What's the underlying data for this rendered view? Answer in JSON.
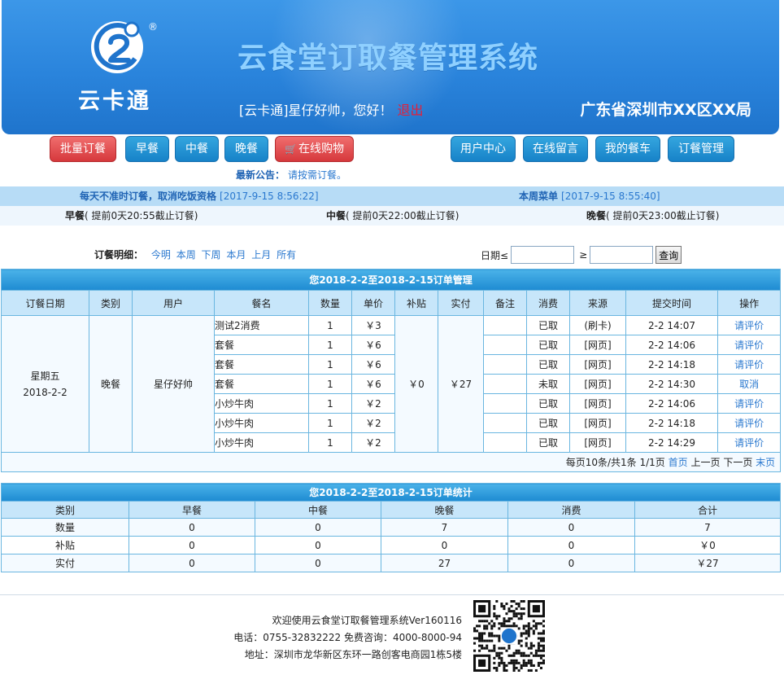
{
  "brand": {
    "name": "云卡通",
    "registered": "®",
    "system_title": "云食堂订取餐管理系统"
  },
  "header": {
    "greeting": "[云卡通]星仔好帅，您好！",
    "logout": "退出",
    "location": "广东省深圳市XX区XX局"
  },
  "nav": {
    "batch_order": "批量订餐",
    "breakfast": "早餐",
    "lunch": "中餐",
    "dinner": "晚餐",
    "shop": "在线购物",
    "user_center": "用户中心",
    "message": "在线留言",
    "cart": "我的餐车",
    "order_manage": "订餐管理"
  },
  "notice": {
    "label": "最新公告：",
    "text": "请按需订餐。"
  },
  "info_bar": {
    "left_text": "每天不准时订餐，取消吃饭资格",
    "left_time": "[2017-9-15 8:56:22]",
    "right_text": "本周菜单",
    "right_time": "[2017-9-15 8:55:40]"
  },
  "meal_times": {
    "breakfast": {
      "name": "早餐",
      "rule": "( 提前0天20:55截止订餐)"
    },
    "lunch": {
      "name": "中餐",
      "rule": "( 提前0天22:00截止订餐)"
    },
    "dinner": {
      "name": "晚餐",
      "rule": "( 提前0天23:00截止订餐)"
    }
  },
  "filter": {
    "label": "订餐明细：",
    "links": [
      "今明",
      "本周",
      "下周",
      "本月",
      "上月",
      "所有"
    ],
    "date_label": "日期≤",
    "ge": "≥",
    "date_from": "",
    "date_to": "",
    "query": "查询"
  },
  "orders": {
    "caption": "您2018-2-2至2018-2-15订单管理",
    "columns": [
      "订餐日期",
      "类别",
      "用户",
      "餐名",
      "数量",
      "单价",
      "补贴",
      "实付",
      "备注",
      "消费",
      "来源",
      "提交时间",
      "操作"
    ],
    "day": "星期五",
    "date": "2018-2-2",
    "category": "晚餐",
    "user": "星仔好帅",
    "subsidy": "￥0",
    "paid": "￥27",
    "rows": [
      {
        "meal": "测试2消费",
        "qty": "1",
        "price": "￥3",
        "remark": "",
        "status": "已取",
        "source": "(刷卡)",
        "time": "2-2 14:07",
        "action": "请评价"
      },
      {
        "meal": "套餐",
        "qty": "1",
        "price": "￥6",
        "remark": "",
        "status": "已取",
        "source": "[网页]",
        "time": "2-2 14:06",
        "action": "请评价"
      },
      {
        "meal": "套餐",
        "qty": "1",
        "price": "￥6",
        "remark": "",
        "status": "已取",
        "source": "[网页]",
        "time": "2-2 14:18",
        "action": "请评价"
      },
      {
        "meal": "套餐",
        "qty": "1",
        "price": "￥6",
        "remark": "",
        "status": "未取",
        "source": "[网页]",
        "time": "2-2 14:30",
        "action": "取消"
      },
      {
        "meal": "小炒牛肉",
        "qty": "1",
        "price": "￥2",
        "remark": "",
        "status": "已取",
        "source": "[网页]",
        "time": "2-2 14:06",
        "action": "请评价"
      },
      {
        "meal": "小炒牛肉",
        "qty": "1",
        "price": "￥2",
        "remark": "",
        "status": "已取",
        "source": "[网页]",
        "time": "2-2 14:18",
        "action": "请评价"
      },
      {
        "meal": "小炒牛肉",
        "qty": "1",
        "price": "￥2",
        "remark": "",
        "status": "已取",
        "source": "[网页]",
        "time": "2-2 14:29",
        "action": "请评价"
      }
    ],
    "pager": {
      "summary": "每页10条/共1条 1/1页",
      "first": "首页",
      "prev": "上一页",
      "next": "下一页",
      "last": "末页"
    }
  },
  "stats": {
    "caption": "您2018-2-2至2018-2-15订单统计",
    "columns": [
      "类别",
      "早餐",
      "中餐",
      "晚餐",
      "消费",
      "合计"
    ],
    "rows": [
      [
        "数量",
        "0",
        "0",
        "7",
        "0",
        "7"
      ],
      [
        "补贴",
        "0",
        "0",
        "0",
        "0",
        "￥0"
      ],
      [
        "实付",
        "0",
        "0",
        "27",
        "0",
        "￥27"
      ]
    ]
  },
  "footer": {
    "welcome": "欢迎使用云食堂订取餐管理系统Ver160116",
    "phone": "电话：0755-32832222 免费咨询：4000-8000-94",
    "address": "地址：深圳市龙华新区东环一路创客电商园1栋5楼"
  },
  "colors": {
    "header_blue": "#2a84dc",
    "title_light_blue": "#8fd0ff",
    "nav_blue": "#1782c8",
    "nav_red": "#d6383c",
    "link_blue": "#2a78cf",
    "logout_red": "#e3203a"
  },
  "icons": {
    "logo": "yun-ka-tong-logo",
    "cart": "shopping-cart-icon",
    "qr": "qr-code"
  }
}
